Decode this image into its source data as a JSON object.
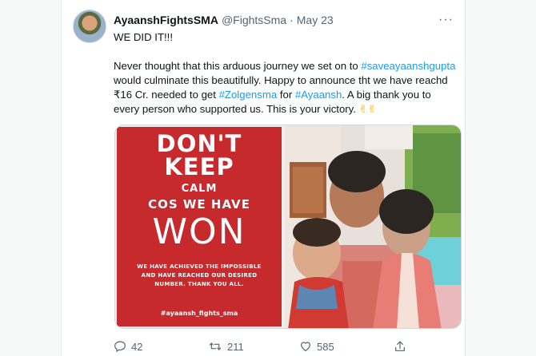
{
  "tweet": {
    "author_name": "AyaanshFightsSMA",
    "author_handle": "@FightsSma",
    "separator": "·",
    "date": "May 23",
    "more_label": "···",
    "line1": "WE DID IT!!!",
    "body_1": "Never thought that this arduous journey we set on to ",
    "hashtag_1": "#saveayaanshgupta",
    "body_2": " would culminate this beautifully. Happy to announce tht we have reachd ₹16 Cr. needed to get ",
    "hashtag_2": "#Zolgensma",
    "body_3": " for ",
    "hashtag_3": "#Ayaansh",
    "body_4": ".  A big thank you to every person who supported us. This is your victory. ",
    "emoji": "✌✌"
  },
  "poster": {
    "line_dont": "DON'T",
    "line_keep": "KEEP",
    "line_calm": "CALM",
    "line_cos": "COS WE HAVE",
    "line_won": "WON",
    "line_small": "WE HAVE ACHIEVED  THE IMPOSSIBLE AND HAVE REACHED OUR DESIRED NUMBER. THANK YOU ALL.",
    "line_hash": "#ayaansh_fights_sma",
    "bg_color": "#c62a2d"
  },
  "actions": {
    "reply_count": "42",
    "retweet_count": "211",
    "like_count": "585"
  },
  "icons": {
    "reply": "reply-icon",
    "retweet": "retweet-icon",
    "like": "heart-icon",
    "share": "share-icon",
    "more": "more-icon"
  },
  "colors": {
    "link": "#1d9bf0",
    "muted": "#536471",
    "text": "#0f1419"
  }
}
